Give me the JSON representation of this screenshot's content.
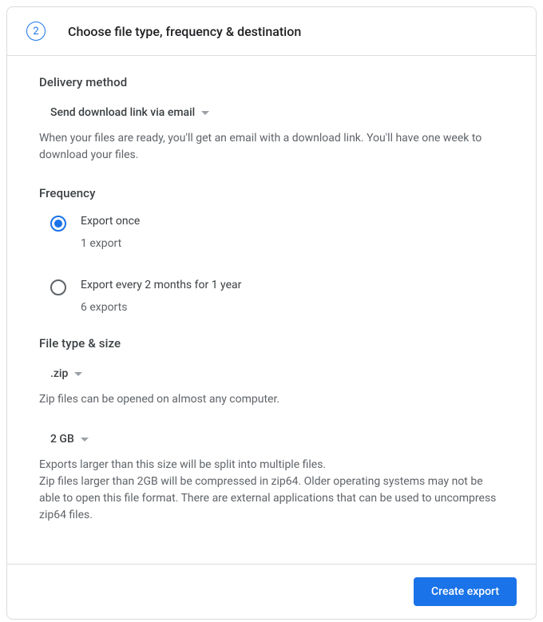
{
  "step": {
    "number": "2",
    "title": "Choose file type, frequency & destination"
  },
  "delivery": {
    "section_title": "Delivery method",
    "selected": "Send download link via email",
    "help": "When your files are ready, you'll get an email with a download link. You'll have one week to download your files."
  },
  "frequency": {
    "section_title": "Frequency",
    "options": [
      {
        "label": "Export once",
        "sub": "1 export",
        "selected": true
      },
      {
        "label": "Export every 2 months for 1 year",
        "sub": "6 exports",
        "selected": false
      }
    ]
  },
  "filetype": {
    "section_title": "File type & size",
    "type_selected": ".zip",
    "type_help": "Zip files can be opened on almost any computer.",
    "size_selected": "2 GB",
    "size_help": "Exports larger than this size will be split into multiple files.\nZip files larger than 2GB will be compressed in zip64. Older operating systems may not be able to open this file format. There are external applications that can be used to uncompress zip64 files."
  },
  "actions": {
    "create_label": "Create export"
  }
}
